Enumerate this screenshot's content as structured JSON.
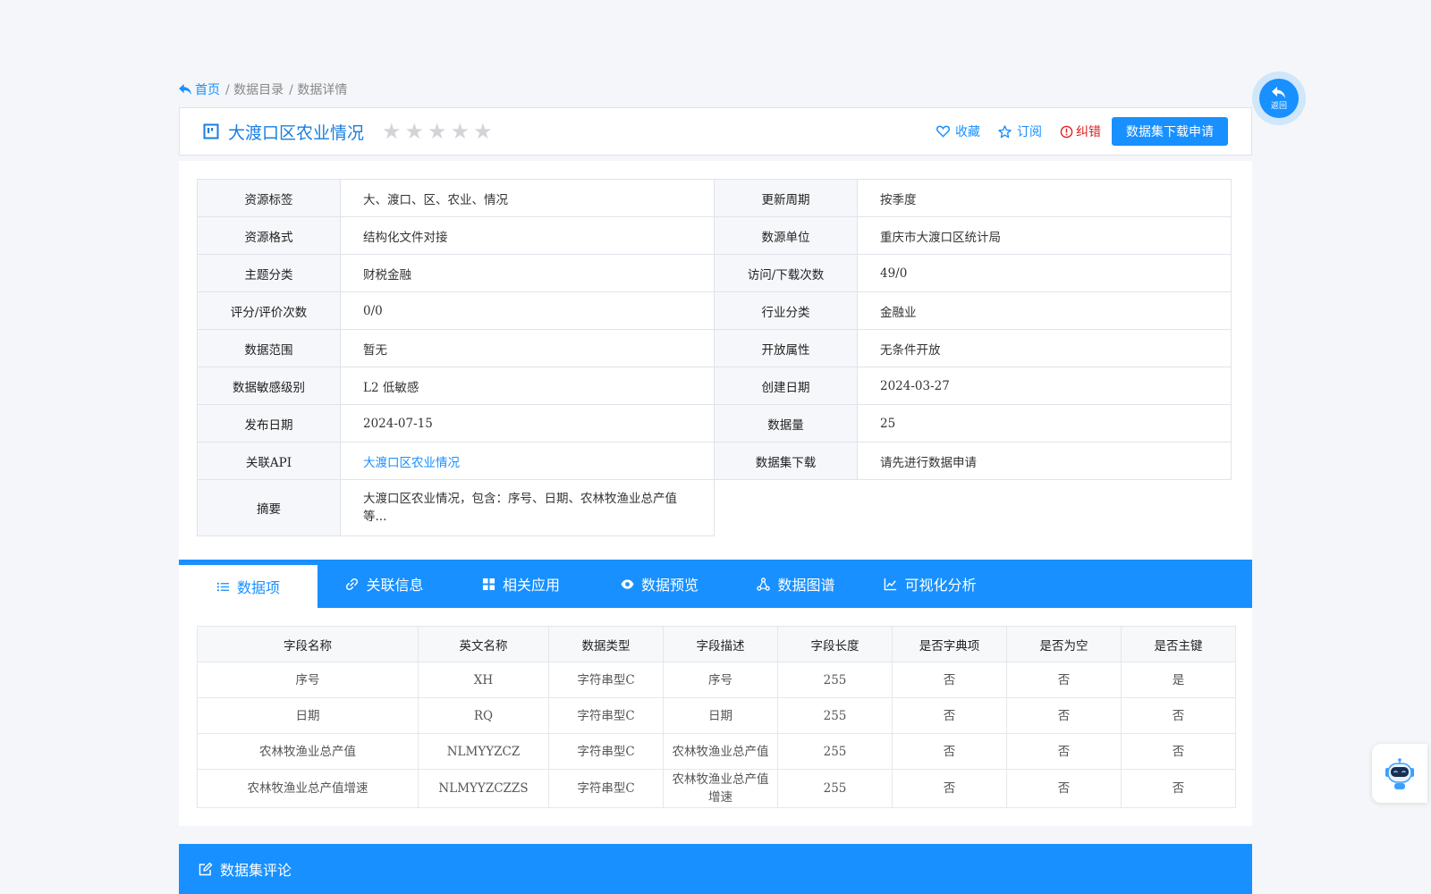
{
  "breadcrumb": {
    "home": "首页",
    "catalog": "/ 数据目录",
    "detail": "/ 数据详情"
  },
  "header": {
    "title": "大渡口区农业情况",
    "rating_stars": 0,
    "favorite": "收藏",
    "subscribe": "订阅",
    "report": "纠错",
    "download_apply": "数据集下载申请"
  },
  "back_button": {
    "label": "返回"
  },
  "info": {
    "rows": [
      {
        "k1": "资源标签",
        "v1": "大、渡口、区、农业、情况",
        "k2": "更新周期",
        "v2": "按季度"
      },
      {
        "k1": "资源格式",
        "v1": "结构化文件对接",
        "k2": "数源单位",
        "v2": "重庆市大渡口区统计局"
      },
      {
        "k1": "主题分类",
        "v1": "财税金融",
        "k2": "访问/下载次数",
        "v2": "49/0"
      },
      {
        "k1": "评分/评价次数",
        "v1": "0/0",
        "k2": "行业分类",
        "v2": "金融业"
      },
      {
        "k1": "数据范围",
        "v1": "暂无",
        "k2": "开放属性",
        "v2": "无条件开放"
      },
      {
        "k1": "数据敏感级别",
        "v1": "L2 低敏感",
        "k2": "创建日期",
        "v2": "2024-03-27"
      },
      {
        "k1": "发布日期",
        "v1": "2024-07-15",
        "k2": "数据量",
        "v2": "25"
      },
      {
        "k1": "关联API",
        "v1": "大渡口区农业情况",
        "k2": "数据集下载",
        "v2": "请先进行数据申请"
      }
    ],
    "summary_label": "摘要",
    "summary_value": "大渡口区农业情况，包含：序号、日期、农林牧渔业总产值等..."
  },
  "tabs": [
    {
      "label": "数据项",
      "icon": "list-icon"
    },
    {
      "label": "关联信息",
      "icon": "link-icon"
    },
    {
      "label": "相关应用",
      "icon": "grid-icon"
    },
    {
      "label": "数据预览",
      "icon": "eye-icon"
    },
    {
      "label": "数据图谱",
      "icon": "graph-icon"
    },
    {
      "label": "可视化分析",
      "icon": "line-chart-icon"
    }
  ],
  "fields_table": {
    "headers": [
      "字段名称",
      "英文名称",
      "数据类型",
      "字段描述",
      "字段长度",
      "是否字典项",
      "是否为空",
      "是否主键"
    ],
    "rows": [
      [
        "序号",
        "XH",
        "字符串型C",
        "序号",
        "255",
        "否",
        "否",
        "是"
      ],
      [
        "日期",
        "RQ",
        "字符串型C",
        "日期",
        "255",
        "否",
        "否",
        "否"
      ],
      [
        "农林牧渔业总产值",
        "NLMYYZCZ",
        "字符串型C",
        "农林牧渔业总产值",
        "255",
        "否",
        "否",
        "否"
      ],
      [
        "农林牧渔业总产值增速",
        "NLMYYZCZZS",
        "字符串型C",
        "农林牧渔业总产值增速",
        "255",
        "否",
        "否",
        "否"
      ]
    ]
  },
  "comments": {
    "title": "数据集评论"
  },
  "colors": {
    "primary": "#1890ff",
    "danger": "#e02020",
    "star_empty": "#d2d4d8"
  }
}
